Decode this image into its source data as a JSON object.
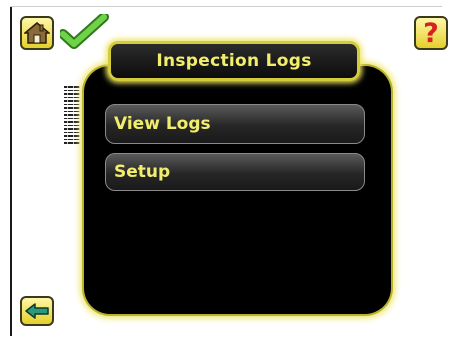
{
  "header": {
    "title": "Inspection Logs",
    "home_icon": "home-icon",
    "status_icon": "checkmark-icon",
    "help_icon": "help-icon",
    "help_glyph": "?"
  },
  "menu": {
    "items": [
      {
        "label": "View Logs"
      },
      {
        "label": "Setup"
      }
    ]
  },
  "footer": {
    "back_icon": "back-arrow-icon"
  },
  "colors": {
    "accent_yellow": "#ece564",
    "title_text": "#f2ee6c",
    "panel": "#000000",
    "status_green": "#5fbf3a",
    "help_red": "#d82020"
  }
}
